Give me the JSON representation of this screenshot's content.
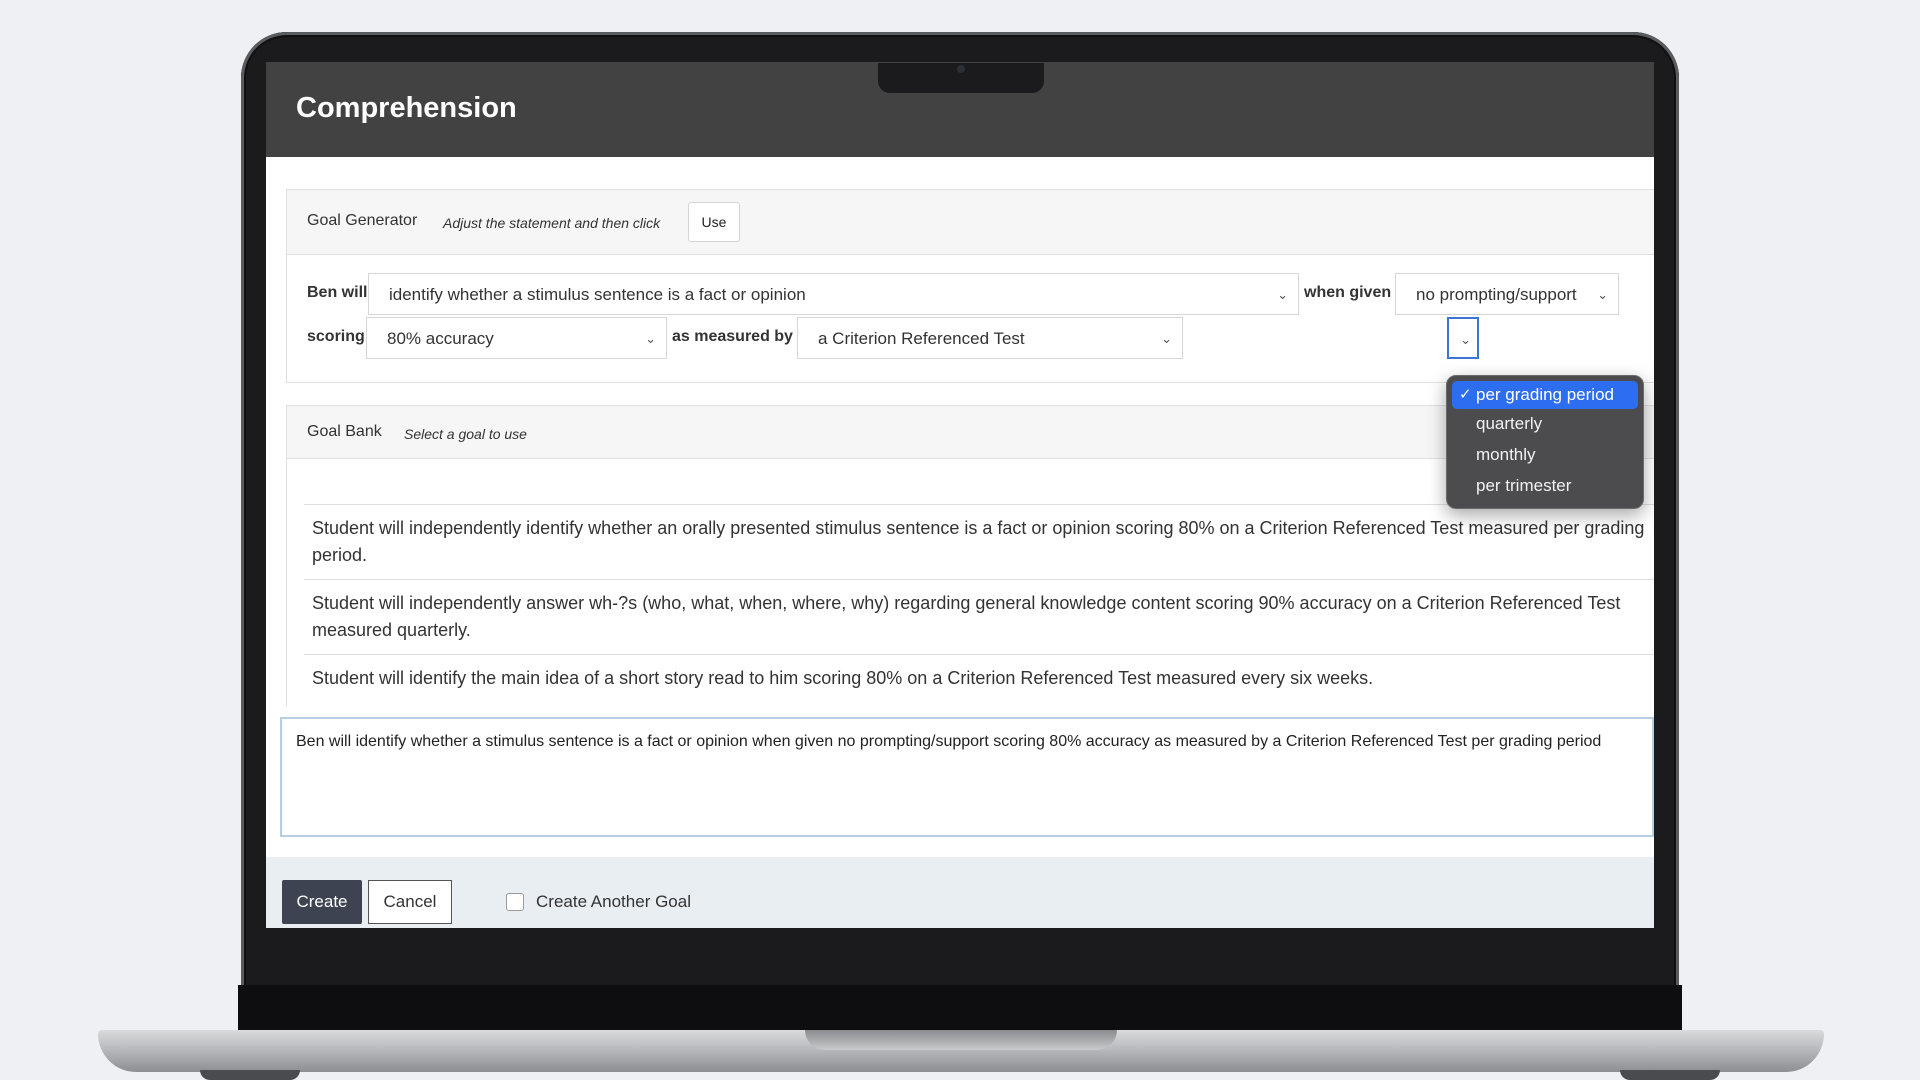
{
  "window": {
    "title": "Comprehension"
  },
  "goal_generator": {
    "title": "Goal Generator",
    "hint": "Adjust the statement and then click",
    "use_label": "Use",
    "ben_will_label": "Ben will",
    "skill_value": "identify whether a stimulus sentence is a fact or opinion",
    "when_given_label": "when given",
    "support_value": "no prompting/support",
    "scoring_label": "scoring",
    "scoring_value": "80% accuracy",
    "measured_by_label": "as measured by",
    "measure_value": "a Criterion Referenced Test",
    "frequency_options": [
      "per grading period",
      "quarterly",
      "monthly",
      "per trimester"
    ],
    "frequency_selected": "per grading period"
  },
  "goal_bank": {
    "title": "Goal Bank",
    "hint": "Select a goal to use",
    "items": [
      "Student will independently identify whether an orally presented stimulus sentence is a fact or opinion scoring 80% on a Criterion Referenced Test measured per grading period.",
      "Student will independently answer wh-?s (who, what, when, where, why) regarding general knowledge content scoring 90% accuracy on a Criterion Referenced Test measured quarterly.",
      "Student will identify the main idea of a short story read to him scoring 80% on a Criterion Referenced Test measured every six weeks."
    ]
  },
  "statement": "Ben will identify whether a stimulus sentence is a fact or opinion when given no prompting/support scoring 80% accuracy as measured by  a Criterion Referenced Test  per grading period",
  "footer": {
    "create_label": "Create",
    "cancel_label": "Cancel",
    "create_another_label": "Create Another Goal",
    "create_another_checked": false
  },
  "icons": {
    "chevron": "chevron-down-icon",
    "check": "checkmark-icon"
  },
  "colors": {
    "titlebar": "#424242",
    "selected_option": "#2d6ef0",
    "create_button": "#3d4350"
  }
}
